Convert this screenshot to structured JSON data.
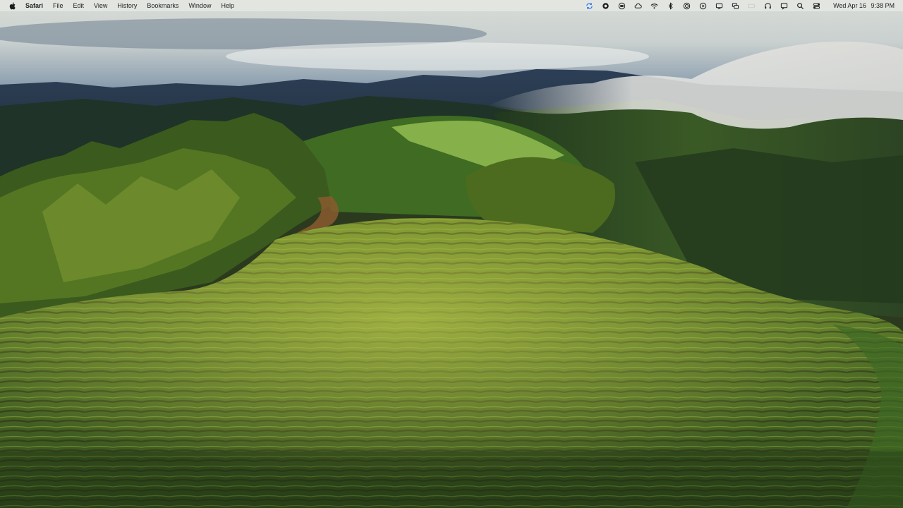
{
  "menubar": {
    "app_name": "Safari",
    "menus": [
      "File",
      "Edit",
      "View",
      "History",
      "Bookmarks",
      "Window",
      "Help"
    ],
    "clock": {
      "date": "Wed Apr 16",
      "time": "9:38 PM"
    },
    "status_icons": [
      "sync-icon",
      "browser-icon",
      "record-icon",
      "cloud-icon",
      "wifi-icon",
      "bluetooth-icon",
      "airdrop-icon",
      "play-icon",
      "display-icon",
      "screen-mirroring-icon",
      "battery-icon",
      "headphones-icon",
      "message-icon",
      "search-icon",
      "control-center-icon"
    ]
  },
  "colors": {
    "menubar_bg": "#e8eae4",
    "sync_accent": "#3478f6"
  }
}
